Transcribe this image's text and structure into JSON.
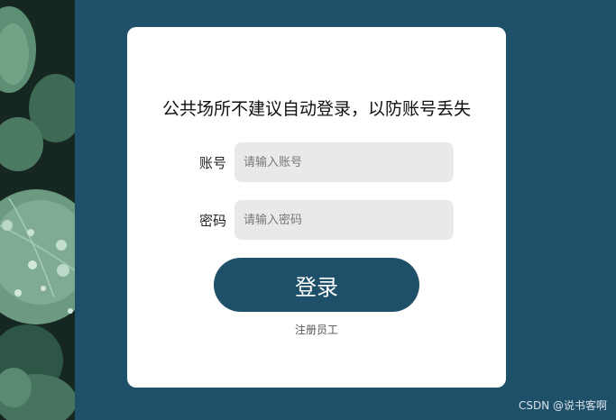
{
  "login_form": {
    "notice": "公共场所不建议自动登录，以防账号丢失",
    "account_label": "账号",
    "account_placeholder": "请输入账号",
    "account_value": "",
    "password_label": "密码",
    "password_placeholder": "请输入密码",
    "password_value": "",
    "login_button_label": "登录",
    "register_link_label": "注册员工"
  },
  "watermark": "CSDN @说书客啊",
  "colors": {
    "background": "#1f5069",
    "card": "#ffffff",
    "input_bg": "#e9e9e9",
    "button": "#1f5069"
  }
}
